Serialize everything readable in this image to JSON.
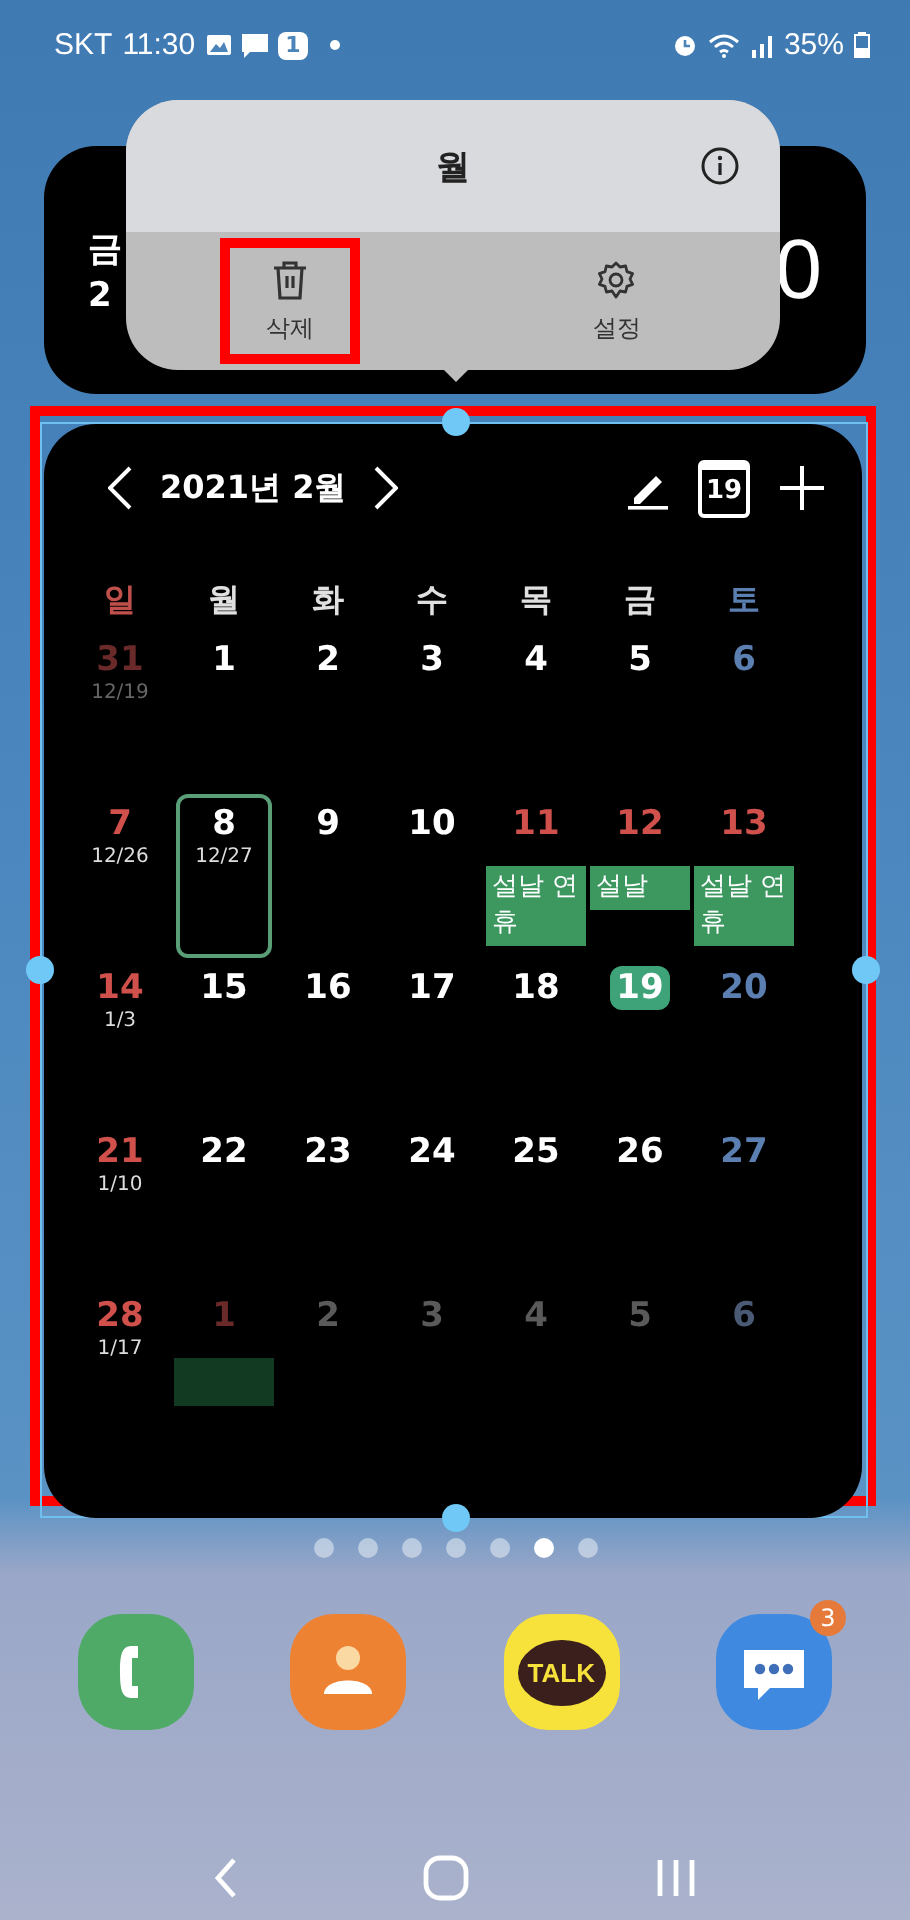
{
  "status_bar": {
    "carrier": "SKT",
    "time": "11:30",
    "notification_count": "1",
    "battery": "35%"
  },
  "clock_widget": {
    "weekday": "금",
    "date": "2",
    "time": "0"
  },
  "widget_menu": {
    "title": "월",
    "actions": [
      {
        "kind": "delete",
        "label": "삭제",
        "highlighted": true
      },
      {
        "kind": "settings",
        "label": "설정",
        "highlighted": false
      }
    ]
  },
  "calendar": {
    "highlighted": true,
    "month": "2021년 2월",
    "weekdays": [
      {
        "label": "일",
        "kind": "sun"
      },
      {
        "label": "월",
        "kind": "day"
      },
      {
        "label": "화",
        "kind": "day"
      },
      {
        "label": "수",
        "kind": "day"
      },
      {
        "label": "목",
        "kind": "day"
      },
      {
        "label": "금",
        "kind": "day"
      },
      {
        "label": "토",
        "kind": "sat"
      }
    ],
    "today_icon": "19",
    "weeks": [
      {
        "days": [
          {
            "day": "31",
            "sub": "12/19",
            "kind": "sun",
            "faded": true,
            "selected": false,
            "today": false
          },
          {
            "day": "1",
            "kind": "day",
            "faded": false,
            "selected": false,
            "today": false
          },
          {
            "day": "2",
            "kind": "day",
            "faded": false,
            "selected": false,
            "today": false
          },
          {
            "day": "3",
            "kind": "day",
            "faded": false,
            "selected": false,
            "today": false
          },
          {
            "day": "4",
            "kind": "day",
            "faded": false,
            "selected": false,
            "today": false
          },
          {
            "day": "5",
            "kind": "day",
            "faded": false,
            "selected": false,
            "today": false
          },
          {
            "day": "6",
            "kind": "sat",
            "faded": false,
            "selected": false,
            "today": false
          }
        ]
      },
      {
        "days": [
          {
            "day": "7",
            "sub": "12/26",
            "kind": "sun",
            "faded": false,
            "selected": false,
            "today": false
          },
          {
            "day": "8",
            "sub": "12/27",
            "kind": "day",
            "faded": false,
            "selected": true,
            "today": false
          },
          {
            "day": "9",
            "kind": "day",
            "faded": false,
            "selected": false,
            "today": false
          },
          {
            "day": "10",
            "kind": "day",
            "faded": false,
            "selected": false,
            "today": false
          },
          {
            "day": "11",
            "kind": "sun",
            "faded": false,
            "selected": false,
            "today": false,
            "event": {
              "label": "설날 연휴",
              "faded": false
            }
          },
          {
            "day": "12",
            "kind": "sun",
            "faded": false,
            "selected": false,
            "today": false,
            "event": {
              "label": "설날",
              "faded": false
            }
          },
          {
            "day": "13",
            "kind": "sun",
            "faded": false,
            "selected": false,
            "today": false,
            "event": {
              "label": "설날 연휴",
              "faded": false
            }
          }
        ]
      },
      {
        "days": [
          {
            "day": "14",
            "sub": "1/3",
            "kind": "sun",
            "faded": false,
            "selected": false,
            "today": false
          },
          {
            "day": "15",
            "kind": "day",
            "faded": false,
            "selected": false,
            "today": false
          },
          {
            "day": "16",
            "kind": "day",
            "faded": false,
            "selected": false,
            "today": false
          },
          {
            "day": "17",
            "kind": "day",
            "faded": false,
            "selected": false,
            "today": false
          },
          {
            "day": "18",
            "kind": "day",
            "faded": false,
            "selected": false,
            "today": false
          },
          {
            "day": "19",
            "kind": "day",
            "faded": false,
            "selected": false,
            "today": true
          },
          {
            "day": "20",
            "kind": "sat",
            "faded": false,
            "selected": false,
            "today": false
          }
        ]
      },
      {
        "days": [
          {
            "day": "21",
            "sub": "1/10",
            "kind": "sun",
            "faded": false,
            "selected": false,
            "today": false
          },
          {
            "day": "22",
            "kind": "day",
            "faded": false,
            "selected": false,
            "today": false
          },
          {
            "day": "23",
            "kind": "day",
            "faded": false,
            "selected": false,
            "today": false
          },
          {
            "day": "24",
            "kind": "day",
            "faded": false,
            "selected": false,
            "today": false
          },
          {
            "day": "25",
            "kind": "day",
            "faded": false,
            "selected": false,
            "today": false
          },
          {
            "day": "26",
            "kind": "day",
            "faded": false,
            "selected": false,
            "today": false
          },
          {
            "day": "27",
            "kind": "sat",
            "faded": false,
            "selected": false,
            "today": false
          }
        ]
      },
      {
        "days": [
          {
            "day": "28",
            "sub": "1/17",
            "kind": "sun",
            "faded": false,
            "selected": false,
            "today": false
          },
          {
            "day": "1",
            "kind": "sun",
            "faded": true,
            "selected": false,
            "today": false,
            "event": {
              "faded": true
            }
          },
          {
            "day": "2",
            "kind": "day",
            "faded": true,
            "selected": false,
            "today": false
          },
          {
            "day": "3",
            "kind": "day",
            "faded": true,
            "selected": false,
            "today": false
          },
          {
            "day": "4",
            "kind": "day",
            "faded": true,
            "selected": false,
            "today": false
          },
          {
            "day": "5",
            "kind": "day",
            "faded": true,
            "selected": false,
            "today": false
          },
          {
            "day": "6",
            "kind": "sat",
            "faded": true,
            "selected": false,
            "today": false
          }
        ]
      }
    ]
  },
  "page_dots": [
    {
      "selected": false
    },
    {
      "selected": false
    },
    {
      "selected": false
    },
    {
      "selected": false
    },
    {
      "selected": false
    },
    {
      "selected": true
    },
    {
      "selected": false
    }
  ],
  "dock": [
    {
      "kind": "phone"
    },
    {
      "kind": "contacts"
    },
    {
      "kind": "talk",
      "label": "TALK"
    },
    {
      "kind": "messages",
      "badge": "3"
    }
  ],
  "nav_bar": [
    {
      "kind": "back"
    },
    {
      "kind": "home"
    },
    {
      "kind": "recents"
    }
  ]
}
